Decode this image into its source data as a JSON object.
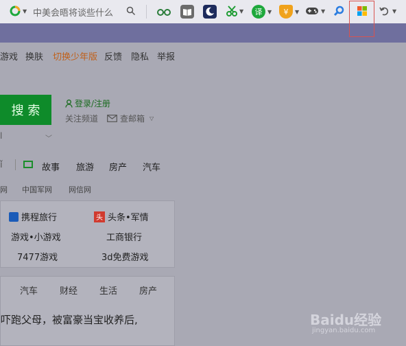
{
  "toolbar": {
    "search_placeholder": "中美会晤将谈些什么",
    "translate_label": "译",
    "shield_label": "¥",
    "highlight_target": "apps-grid-icon"
  },
  "nav": {
    "items": [
      "游戏",
      "换肤",
      "切换少年版",
      "反馈",
      "隐私",
      "举报"
    ]
  },
  "search": {
    "button_label": "搜 索",
    "login_label": "登录/注册",
    "follow_label": "关注频道",
    "mail_label": "查邮箱",
    "left_fragment": "l"
  },
  "categories": [
    "故事",
    "旅游",
    "房产",
    "汽车"
  ],
  "category_left_fragment": "ǐ",
  "links": [
    "网",
    "中国军网",
    "网信网"
  ],
  "card1": {
    "items": [
      "携程旅行",
      "头条•军情",
      "游戏•小游戏",
      "工商银行",
      "7477游戏",
      "3d免费游戏"
    ],
    "toutiao_icon_text": "头"
  },
  "card2": {
    "tabs": [
      "汽车",
      "财经",
      "生活",
      "房产"
    ],
    "headline": "吓跑父母，被富豪当宝收养后,"
  },
  "watermark": {
    "brand": "Baidu经验",
    "url": "jingyan.baidu.com"
  },
  "colors": {
    "accent_green": "#0e8b2a",
    "highlight_red": "#d9534f",
    "orange_link": "#c0601a"
  }
}
